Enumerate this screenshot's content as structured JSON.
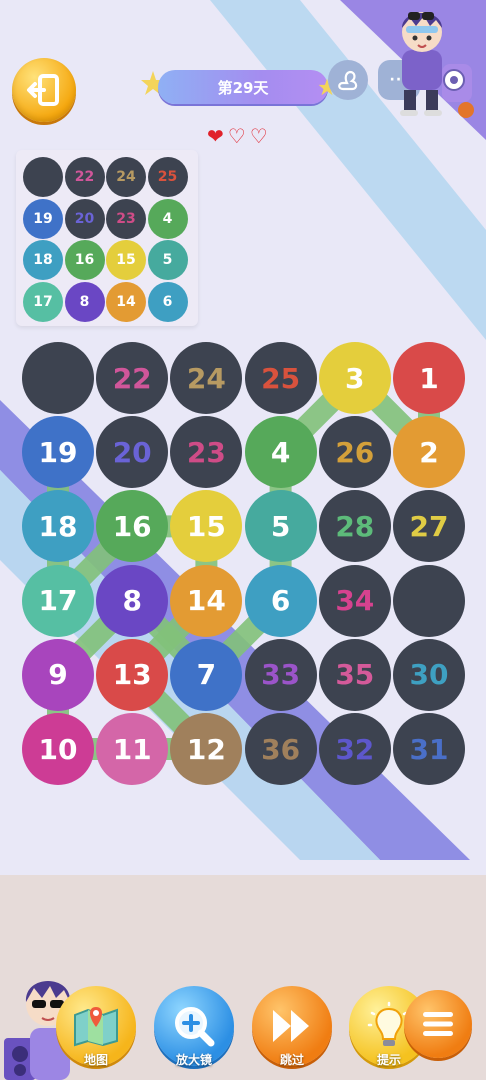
{
  "header": {
    "title": "第29天",
    "hearts": [
      {
        "name": "heart-full",
        "symbol": "❤"
      },
      {
        "name": "heart-empty",
        "symbol": "♡"
      },
      {
        "name": "heart-empty",
        "symbol": "♡"
      }
    ],
    "more_label": "···"
  },
  "colors": {
    "dark": "#3d4350",
    "red": "#d94a49",
    "orange": "#e39b33",
    "yellow": "#e4ce3c",
    "green": "#56a95a",
    "teal": "#46aa9e",
    "cyan": "#3e9fc2",
    "blue": "#3f72c8",
    "purple": "#6a47c4",
    "magenta": "#a845bd",
    "pink": "#cd3c95",
    "rose": "#d466a8",
    "brown": "#a0805c",
    "mint": "#56bfa3",
    "path": "#82c27a"
  },
  "mini_grid": [
    [
      {
        "n": "",
        "bg": "dark",
        "fg": "#ffffff"
      },
      {
        "n": "22",
        "bg": "dark",
        "fg": "#d0569a"
      },
      {
        "n": "24",
        "bg": "dark",
        "fg": "#b79a62"
      },
      {
        "n": "25",
        "bg": "dark",
        "fg": "#d9523d"
      }
    ],
    [
      {
        "n": "19",
        "bg": "blue",
        "fg": "#ffffff"
      },
      {
        "n": "20",
        "bg": "dark",
        "fg": "#6a63d6"
      },
      {
        "n": "23",
        "bg": "dark",
        "fg": "#cf4c87"
      },
      {
        "n": "4",
        "bg": "green",
        "fg": "#ffffff"
      }
    ],
    [
      {
        "n": "18",
        "bg": "cyan",
        "fg": "#ffffff"
      },
      {
        "n": "16",
        "bg": "green",
        "fg": "#ffffff"
      },
      {
        "n": "15",
        "bg": "yellow",
        "fg": "#ffffff"
      },
      {
        "n": "5",
        "bg": "teal",
        "fg": "#ffffff"
      }
    ],
    [
      {
        "n": "17",
        "bg": "mint",
        "fg": "#ffffff"
      },
      {
        "n": "8",
        "bg": "purple",
        "fg": "#ffffff"
      },
      {
        "n": "14",
        "bg": "orange",
        "fg": "#ffffff"
      },
      {
        "n": "6",
        "bg": "cyan",
        "fg": "#ffffff"
      }
    ]
  ],
  "grid": [
    [
      {
        "n": "",
        "bg": "dark",
        "fg": "#ffffff"
      },
      {
        "n": "22",
        "bg": "dark",
        "fg": "#d0569a"
      },
      {
        "n": "24",
        "bg": "dark",
        "fg": "#b79a62"
      },
      {
        "n": "25",
        "bg": "dark",
        "fg": "#d9523d"
      },
      {
        "n": "3",
        "bg": "yellow",
        "fg": "#ffffff"
      },
      {
        "n": "1",
        "bg": "red",
        "fg": "#ffffff"
      }
    ],
    [
      {
        "n": "19",
        "bg": "blue",
        "fg": "#ffffff"
      },
      {
        "n": "20",
        "bg": "dark",
        "fg": "#6a63d6"
      },
      {
        "n": "23",
        "bg": "dark",
        "fg": "#cf4c87"
      },
      {
        "n": "4",
        "bg": "green",
        "fg": "#ffffff"
      },
      {
        "n": "26",
        "bg": "dark",
        "fg": "#d4a03a"
      },
      {
        "n": "2",
        "bg": "orange",
        "fg": "#ffffff"
      }
    ],
    [
      {
        "n": "18",
        "bg": "cyan",
        "fg": "#ffffff"
      },
      {
        "n": "16",
        "bg": "green",
        "fg": "#ffffff"
      },
      {
        "n": "15",
        "bg": "yellow",
        "fg": "#ffffff"
      },
      {
        "n": "5",
        "bg": "teal",
        "fg": "#ffffff"
      },
      {
        "n": "28",
        "bg": "dark",
        "fg": "#5dbb7a"
      },
      {
        "n": "27",
        "bg": "dark",
        "fg": "#e0cc45"
      }
    ],
    [
      {
        "n": "17",
        "bg": "mint",
        "fg": "#ffffff"
      },
      {
        "n": "8",
        "bg": "purple",
        "fg": "#ffffff"
      },
      {
        "n": "14",
        "bg": "orange",
        "fg": "#ffffff"
      },
      {
        "n": "6",
        "bg": "cyan",
        "fg": "#ffffff"
      },
      {
        "n": "34",
        "bg": "dark",
        "fg": "#d6428f"
      },
      {
        "n": "",
        "bg": "dark",
        "fg": "#ffffff"
      }
    ],
    [
      {
        "n": "9",
        "bg": "magenta",
        "fg": "#ffffff"
      },
      {
        "n": "13",
        "bg": "red",
        "fg": "#ffffff"
      },
      {
        "n": "7",
        "bg": "blue",
        "fg": "#ffffff"
      },
      {
        "n": "33",
        "bg": "dark",
        "fg": "#9b54c9"
      },
      {
        "n": "35",
        "bg": "dark",
        "fg": "#d45a9a"
      },
      {
        "n": "30",
        "bg": "dark",
        "fg": "#3ea0c2"
      }
    ],
    [
      {
        "n": "10",
        "bg": "pink",
        "fg": "#ffffff"
      },
      {
        "n": "11",
        "bg": "rose",
        "fg": "#ffffff"
      },
      {
        "n": "12",
        "bg": "brown",
        "fg": "#ffffff"
      },
      {
        "n": "36",
        "bg": "dark",
        "fg": "#a0805c"
      },
      {
        "n": "32",
        "bg": "dark",
        "fg": "#5d57cc"
      },
      {
        "n": "31",
        "bg": "dark",
        "fg": "#4a6fc8"
      }
    ]
  ],
  "path_order": [
    "1",
    "2",
    "3",
    "4",
    "5",
    "6",
    "7",
    "8",
    "9",
    "10",
    "11",
    "12",
    "13",
    "14",
    "15",
    "16",
    "17",
    "18",
    "19"
  ],
  "toolbar": [
    {
      "name": "map-button",
      "label": "地图",
      "icon": "map-icon",
      "color": "yellow"
    },
    {
      "name": "magnifier-button",
      "label": "放大镜",
      "icon": "magnifier-icon",
      "color": "blue"
    },
    {
      "name": "skip-button",
      "label": "跳过",
      "icon": "fast-forward-icon",
      "color": "orange"
    },
    {
      "name": "hint-button",
      "label": "提示",
      "icon": "lightbulb-icon",
      "color": "yellow"
    },
    {
      "name": "menu-button",
      "label": "",
      "icon": "menu-icon",
      "color": "orange"
    }
  ]
}
